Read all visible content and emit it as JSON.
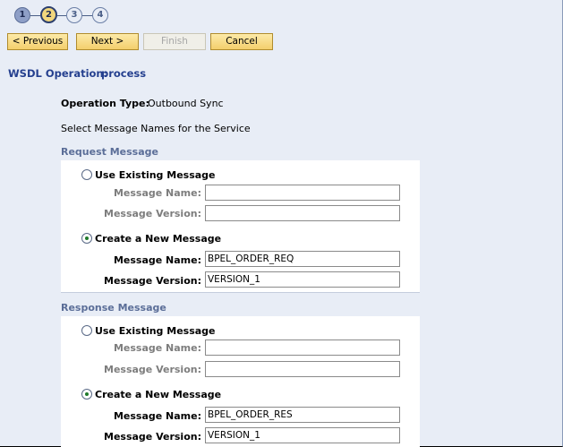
{
  "wizard": {
    "steps": [
      "1",
      "2",
      "3",
      "4"
    ],
    "current_step": 2
  },
  "toolbar": {
    "previous_label": "< Previous",
    "next_label": "Next >",
    "finish_label": "Finish",
    "cancel_label": "Cancel"
  },
  "operation": {
    "label": "WSDL Operation:",
    "value": "process",
    "type_label": "Operation Type:",
    "type_value": "Outbound Sync",
    "select_text": "Select Message Names for the Service"
  },
  "request": {
    "title": "Request Message",
    "use_existing_label": "Use Existing Message",
    "create_new_label": "Create a New Message",
    "selected": "create",
    "existing": {
      "name_label": "Message Name:",
      "name_value": "",
      "version_label": "Message Version:",
      "version_value": ""
    },
    "new": {
      "name_label": "Message Name:",
      "name_value": "BPEL_ORDER_REQ",
      "version_label": "Message Version:",
      "version_value": "VERSION_1"
    }
  },
  "response": {
    "title": "Response Message",
    "use_existing_label": "Use Existing Message",
    "create_new_label": "Create a New Message",
    "selected": "create",
    "existing": {
      "name_label": "Message Name:",
      "name_value": "",
      "version_label": "Message Version:",
      "version_value": ""
    },
    "new": {
      "name_label": "Message Name:",
      "name_value": "BPEL_ORDER_RES",
      "version_label": "Message Version:",
      "version_value": "VERSION_1"
    }
  },
  "colors": {
    "background": "#e8edf6",
    "heading_blue": "#25408f",
    "section_title": "#5b6e98",
    "button_gold": "#f3cf6c"
  }
}
